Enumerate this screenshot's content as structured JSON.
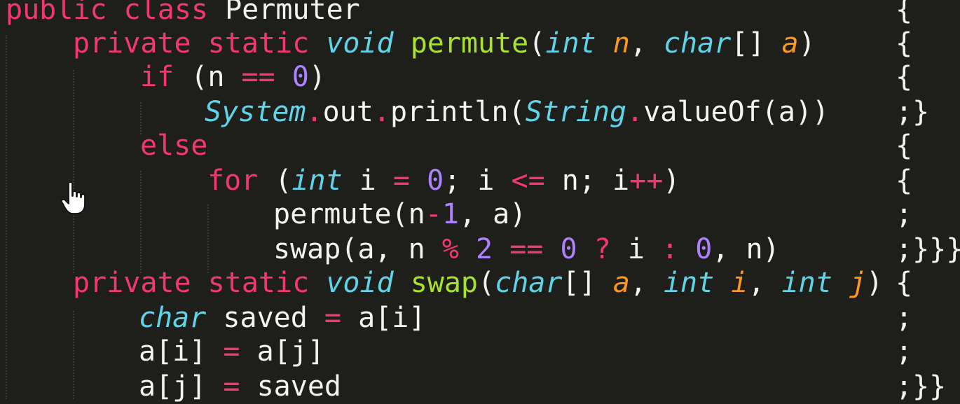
{
  "editor": {
    "theme": {
      "background": "#1e1f1b",
      "keyword": "#f2386f",
      "type": "#5fd3e8",
      "function": "#a6e22e",
      "parameter": "#fd971f",
      "number": "#ae81ff",
      "plain": "#f4f4ee"
    },
    "lines": [
      {
        "tokens": [
          {
            "text": "public",
            "kind": "kw"
          },
          {
            "text": " ",
            "kind": "pl"
          },
          {
            "text": "class",
            "kind": "kw"
          },
          {
            "text": " Permuter",
            "kind": "pl"
          }
        ],
        "brace": "{"
      },
      {
        "tokens": [
          {
            "text": "private",
            "kind": "kw"
          },
          {
            "text": " ",
            "kind": "pl"
          },
          {
            "text": "static",
            "kind": "kw"
          },
          {
            "text": " ",
            "kind": "pl"
          },
          {
            "text": "void",
            "kind": "ty"
          },
          {
            "text": " ",
            "kind": "pl"
          },
          {
            "text": "permute",
            "kind": "fn"
          },
          {
            "text": "(",
            "kind": "pl"
          },
          {
            "text": "int",
            "kind": "ty"
          },
          {
            "text": " ",
            "kind": "pl"
          },
          {
            "text": "n",
            "kind": "pa"
          },
          {
            "text": ", ",
            "kind": "pl"
          },
          {
            "text": "char",
            "kind": "ty"
          },
          {
            "text": "[] ",
            "kind": "pl"
          },
          {
            "text": "a",
            "kind": "pa"
          },
          {
            "text": ")",
            "kind": "pl"
          }
        ],
        "brace": "{"
      },
      {
        "tokens": [
          {
            "text": "if",
            "kind": "kw"
          },
          {
            "text": " (n ",
            "kind": "pl"
          },
          {
            "text": "==",
            "kind": "op"
          },
          {
            "text": " ",
            "kind": "pl"
          },
          {
            "text": "0",
            "kind": "nu"
          },
          {
            "text": ")",
            "kind": "pl"
          }
        ],
        "brace": "{"
      },
      {
        "tokens": [
          {
            "text": "System",
            "kind": "ty"
          },
          {
            "text": ".",
            "kind": "op"
          },
          {
            "text": "out",
            "kind": "pl"
          },
          {
            "text": ".",
            "kind": "op"
          },
          {
            "text": "println(",
            "kind": "pl"
          },
          {
            "text": "String",
            "kind": "ty"
          },
          {
            "text": ".",
            "kind": "op"
          },
          {
            "text": "valueOf(a))",
            "kind": "pl"
          }
        ],
        "brace": ";}"
      },
      {
        "tokens": [
          {
            "text": "else",
            "kind": "kw"
          }
        ],
        "brace": "{"
      },
      {
        "tokens": [
          {
            "text": "for",
            "kind": "kw"
          },
          {
            "text": " (",
            "kind": "pl"
          },
          {
            "text": "int",
            "kind": "ty"
          },
          {
            "text": " i ",
            "kind": "pl"
          },
          {
            "text": "=",
            "kind": "op"
          },
          {
            "text": " ",
            "kind": "pl"
          },
          {
            "text": "0",
            "kind": "nu"
          },
          {
            "text": "; i ",
            "kind": "pl"
          },
          {
            "text": "<=",
            "kind": "op"
          },
          {
            "text": " n; i",
            "kind": "pl"
          },
          {
            "text": "++",
            "kind": "op"
          },
          {
            "text": ")",
            "kind": "pl"
          }
        ],
        "brace": "{"
      },
      {
        "tokens": [
          {
            "text": "permute(n",
            "kind": "pl"
          },
          {
            "text": "-",
            "kind": "op"
          },
          {
            "text": "1",
            "kind": "nu"
          },
          {
            "text": ", a)",
            "kind": "pl"
          }
        ],
        "brace": ";"
      },
      {
        "tokens": [
          {
            "text": "swap(a, n ",
            "kind": "pl"
          },
          {
            "text": "%",
            "kind": "op"
          },
          {
            "text": " ",
            "kind": "pl"
          },
          {
            "text": "2",
            "kind": "nu"
          },
          {
            "text": " ",
            "kind": "pl"
          },
          {
            "text": "==",
            "kind": "op"
          },
          {
            "text": " ",
            "kind": "pl"
          },
          {
            "text": "0",
            "kind": "nu"
          },
          {
            "text": " ",
            "kind": "pl"
          },
          {
            "text": "?",
            "kind": "op"
          },
          {
            "text": " i ",
            "kind": "pl"
          },
          {
            "text": ":",
            "kind": "op"
          },
          {
            "text": " ",
            "kind": "pl"
          },
          {
            "text": "0",
            "kind": "nu"
          },
          {
            "text": ", n)",
            "kind": "pl"
          }
        ],
        "brace": ";}}}"
      },
      {
        "tokens": [
          {
            "text": "private",
            "kind": "kw"
          },
          {
            "text": " ",
            "kind": "pl"
          },
          {
            "text": "static",
            "kind": "kw"
          },
          {
            "text": " ",
            "kind": "pl"
          },
          {
            "text": "void",
            "kind": "ty"
          },
          {
            "text": " ",
            "kind": "pl"
          },
          {
            "text": "swap",
            "kind": "fn"
          },
          {
            "text": "(",
            "kind": "pl"
          },
          {
            "text": "char",
            "kind": "ty"
          },
          {
            "text": "[] ",
            "kind": "pl"
          },
          {
            "text": "a",
            "kind": "pa"
          },
          {
            "text": ", ",
            "kind": "pl"
          },
          {
            "text": "int",
            "kind": "ty"
          },
          {
            "text": " ",
            "kind": "pl"
          },
          {
            "text": "i",
            "kind": "pa"
          },
          {
            "text": ", ",
            "kind": "pl"
          },
          {
            "text": "int",
            "kind": "ty"
          },
          {
            "text": " ",
            "kind": "pl"
          },
          {
            "text": "j",
            "kind": "pa"
          },
          {
            "text": ")",
            "kind": "pl"
          }
        ],
        "brace": "{"
      },
      {
        "tokens": [
          {
            "text": "char",
            "kind": "ty"
          },
          {
            "text": " saved ",
            "kind": "pl"
          },
          {
            "text": "=",
            "kind": "op"
          },
          {
            "text": " a[i]",
            "kind": "pl"
          }
        ],
        "brace": ";"
      },
      {
        "tokens": [
          {
            "text": "a[i] ",
            "kind": "pl"
          },
          {
            "text": "=",
            "kind": "op"
          },
          {
            "text": " a[j]",
            "kind": "pl"
          }
        ],
        "brace": ";"
      },
      {
        "tokens": [
          {
            "text": "a[j] ",
            "kind": "pl"
          },
          {
            "text": "=",
            "kind": "op"
          },
          {
            "text": " saved",
            "kind": "pl"
          }
        ],
        "brace": ";}}"
      }
    ],
    "pointer_icon": "hand-pointer-icon"
  }
}
